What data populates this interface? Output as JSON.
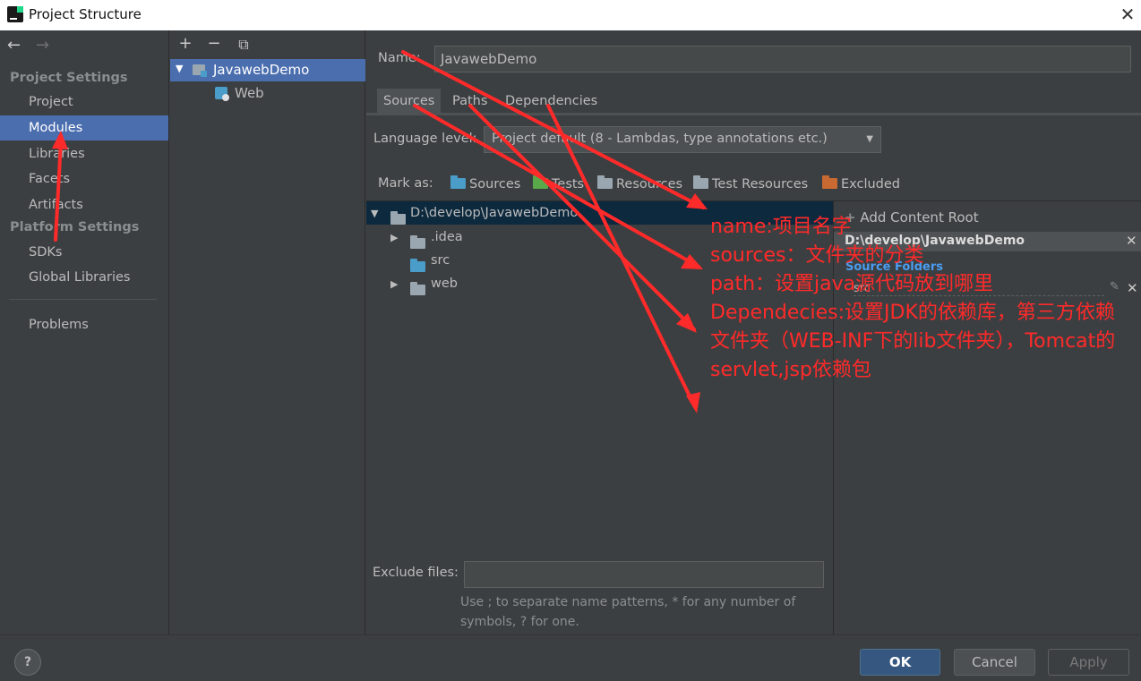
{
  "window": {
    "title": "Project Structure",
    "close_glyph": "✕"
  },
  "nav": {
    "back_glyph": "←",
    "forward_glyph": "→",
    "project_settings_title": "Project Settings",
    "project_settings": [
      "Project",
      "Modules",
      "Libraries",
      "Facets",
      "Artifacts"
    ],
    "platform_settings_title": "Platform Settings",
    "platform_settings": [
      "SDKs",
      "Global Libraries"
    ],
    "problems": "Problems"
  },
  "module_tree": {
    "add_glyph": "+",
    "remove_glyph": "−",
    "copy_glyph": "⧉",
    "module_name": "JavawebDemo",
    "facet_name": "Web"
  },
  "module": {
    "name_label": "Name:",
    "name_value": "JavawebDemo",
    "tabs": [
      "Sources",
      "Paths",
      "Dependencies"
    ],
    "language_level_label": "Language level:",
    "language_level_value": "Project default (8 - Lambdas, type annotations etc.)",
    "mark_as_label": "Mark as:",
    "mark_as": [
      "Sources",
      "Tests",
      "Resources",
      "Test Resources",
      "Excluded"
    ],
    "tree": {
      "root": "D:\\develop\\JavawebDemo",
      "children": [
        ".idea",
        "src",
        "web"
      ]
    },
    "content_root": {
      "add_label": "Add Content Root",
      "path": "D:\\develop\\JavawebDemo",
      "source_folders_title": "Source Folders",
      "source_folder": "src"
    },
    "exclude_files_label": "Exclude files:",
    "exclude_files_value": "",
    "exclude_hint_line1": "Use ; to separate name patterns, * for any number of",
    "exclude_hint_line2": "symbols, ? for one."
  },
  "footer": {
    "help": "?",
    "ok": "OK",
    "cancel": "Cancel",
    "apply": "Apply"
  },
  "annotations": [
    "name:项目名字",
    "sources：文件夹的分类",
    "path：设置java源代码放到哪里",
    "Dependecies:设置JDK的依赖库，第三方依赖文件夹（WEB-INF下的lib文件夹），Tomcat的servlet,jsp依赖包"
  ],
  "colors": {
    "accent": "#4b6eaf",
    "annotation": "#ff2a2a",
    "source_folder": "#4a9cc9",
    "test_folder": "#59a84a",
    "excluded_folder": "#c96a32"
  }
}
